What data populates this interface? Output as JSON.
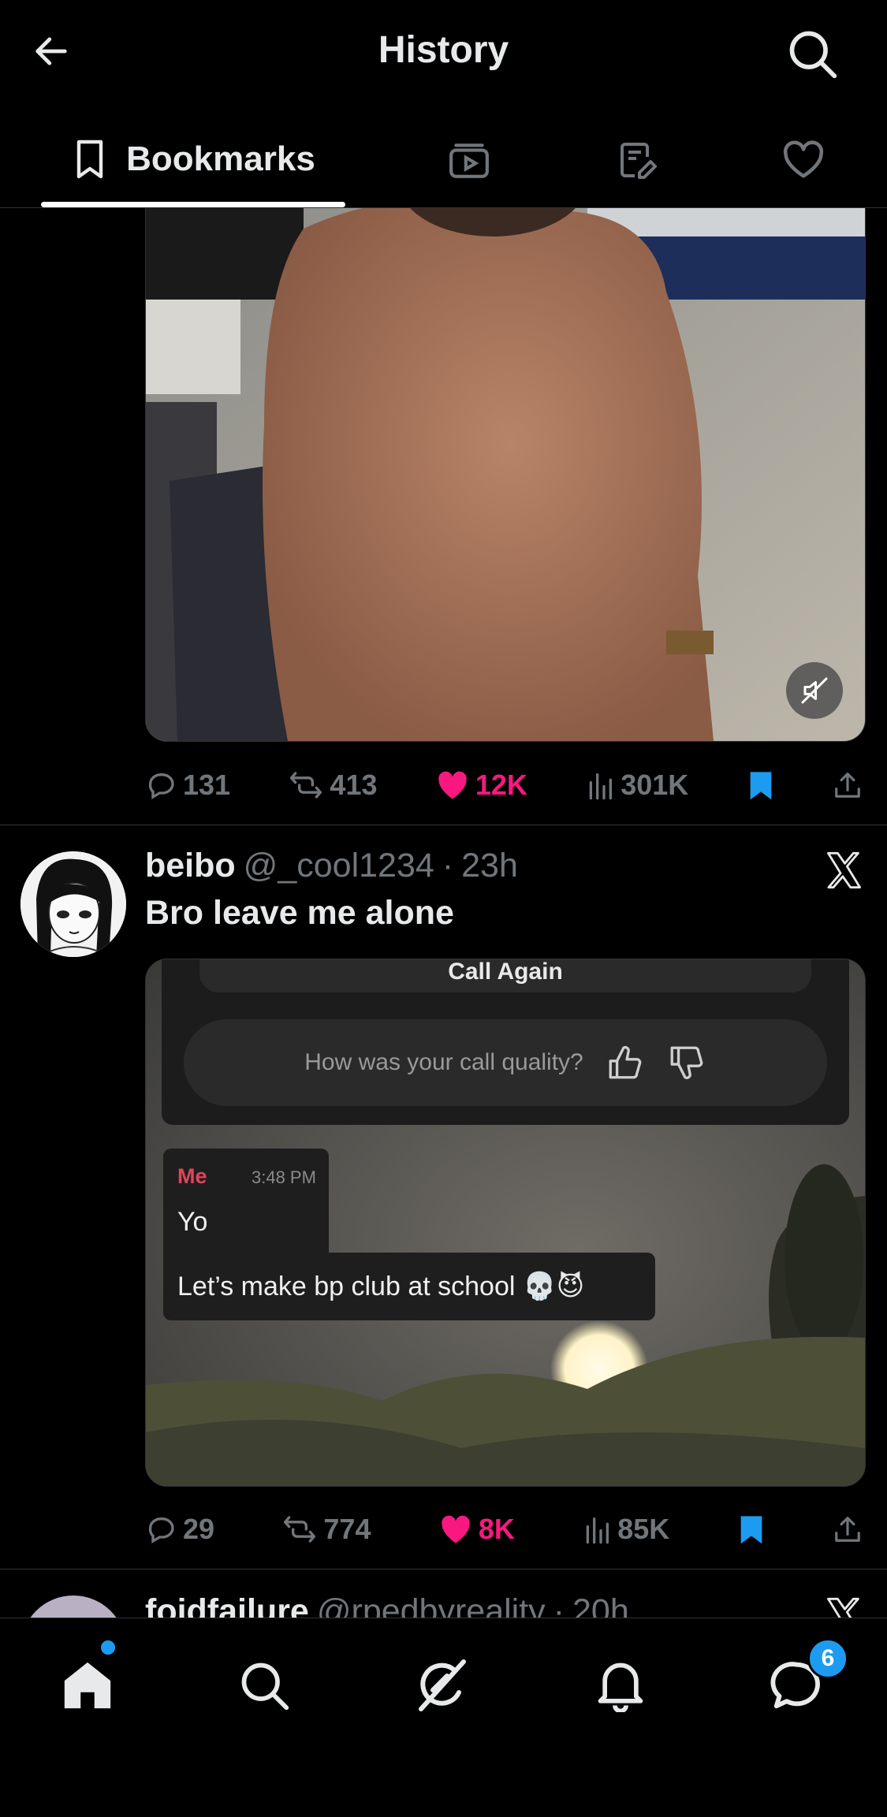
{
  "header": {
    "title": "History",
    "tabs": [
      {
        "label": "Bookmarks",
        "icon": "bookmark-icon",
        "active": true
      },
      {
        "label": "",
        "icon": "video-icon"
      },
      {
        "label": "",
        "icon": "edit-note-icon"
      },
      {
        "label": "",
        "icon": "heart-icon"
      }
    ]
  },
  "posts": [
    {
      "media": {
        "type": "video",
        "muted": true
      },
      "stats": {
        "replies": "131",
        "reposts": "413",
        "likes": "12K",
        "views": "301K",
        "bookmarked": true
      }
    },
    {
      "author_name": "beibo",
      "author_handle": "@_cool1234",
      "separator": "·",
      "time": "23h",
      "text": "Bro leave me alone",
      "screenshot": {
        "call_again": "Call Again",
        "call_quality": "How was your call quality?",
        "msg_sender": "Me",
        "msg_time": "3:48 PM",
        "msg1": "Yo",
        "msg2": "Let’s make bp club at school",
        "msg2_emoji": "💀😈"
      },
      "stats": {
        "replies": "29",
        "reposts": "774",
        "likes": "8K",
        "views": "85K",
        "bookmarked": true
      }
    },
    {
      "author_name": "foidfailure",
      "author_handle": "@rpedbyreality",
      "separator": "·",
      "time": "20h"
    }
  ],
  "bottom_nav": {
    "items": [
      "home-icon",
      "search-icon",
      "grok-icon",
      "notifications-icon",
      "messages-icon"
    ],
    "messages_badge": "6"
  },
  "colors": {
    "like": "#f91880",
    "bookmark": "#1d9bf0",
    "muted_text": "#71767b",
    "background": "#000000"
  }
}
